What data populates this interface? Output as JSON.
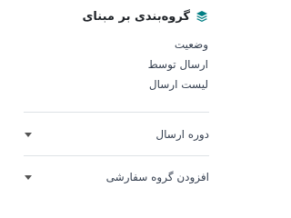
{
  "header": {
    "title": "گروه‌بندی بر مبنای",
    "icon": "layers-icon",
    "icon_color": "#017e84"
  },
  "group_options": [
    {
      "label": "وضعیت"
    },
    {
      "label": "ارسال توسط"
    },
    {
      "label": "لیست ارسال"
    }
  ],
  "sections": [
    {
      "label": "دوره ارسال",
      "icon": "caret-down-icon"
    },
    {
      "label": "افزودن گروه سفارشی",
      "icon": "caret-down-icon"
    }
  ]
}
